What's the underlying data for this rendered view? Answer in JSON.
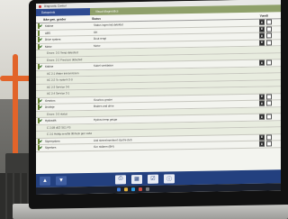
{
  "app": {
    "title": "Diagnostic Control",
    "tabs": [
      {
        "label": "Datapoints",
        "active": true
      },
      {
        "label": "Visual diagnostics",
        "active": false
      }
    ]
  },
  "table": {
    "headers": [
      "Ikke gen. grader",
      "Status",
      "Værdi"
    ],
    "rows": [
      {
        "label": "Kabine",
        "desc": "Status ingen fejl detektet",
        "checked": true,
        "type": "main"
      },
      {
        "label": "ABS",
        "desc": "OK",
        "checked": false,
        "type": "main"
      },
      {
        "label": "Drive system",
        "desc": "Dout rengt",
        "checked": true,
        "type": "main"
      },
      {
        "label": "Motor",
        "desc": "Motor",
        "checked": true,
        "type": "main"
      },
      {
        "label": "Errors: 3-3 Temp detected",
        "desc": "",
        "checked": false,
        "type": "sub"
      },
      {
        "label": "Errors: 2-2 Pressure detected",
        "desc": "",
        "checked": false,
        "type": "sub"
      },
      {
        "label": "Kabine",
        "desc": "Kabel ventilation",
        "checked": true,
        "type": "main"
      },
      {
        "label": "AC 2:1 Water transmission",
        "desc": "",
        "checked": false,
        "type": "sub"
      },
      {
        "label": "AC 2:2 To system 3-0",
        "desc": "",
        "checked": false,
        "type": "sub"
      },
      {
        "label": "AC 2:3 Service 3-0",
        "desc": "",
        "checked": false,
        "type": "sub"
      },
      {
        "label": "AC 2:4 Service 3-1",
        "desc": "",
        "checked": false,
        "type": "sub"
      },
      {
        "label": "Gearbox",
        "desc": "Gearbox grader",
        "checked": true,
        "type": "main"
      },
      {
        "label": "Drivlinje",
        "desc": "Brakes and drive",
        "checked": true,
        "type": "main"
      },
      {
        "label": "Errors: 3-3 status",
        "desc": "",
        "checked": false,
        "type": "sub"
      },
      {
        "label": "Hydraulik",
        "desc": "Hydrau temp gauge",
        "checked": true,
        "type": "main"
      },
      {
        "label": "C 2,5B dE3 SE1 FS",
        "desc": "",
        "checked": false,
        "type": "sub"
      },
      {
        "label": "C 2,5 Hdrlig sensfel tilbhvsk gen valve",
        "desc": "",
        "checked": false,
        "type": "sub"
      },
      {
        "label": "Styresystem",
        "desc": "Anti steerelmenteert stystre (tel)",
        "checked": true,
        "type": "main"
      },
      {
        "label": "Styrelses",
        "desc": "Ger stdlarm (BH)",
        "checked": true,
        "type": "main"
      }
    ]
  },
  "toolbar": {
    "buttons": [
      {
        "name": "up-arrow-icon",
        "glyph": "▲"
      },
      {
        "name": "down-arrow-icon",
        "glyph": "▼"
      },
      {
        "name": "print-icon",
        "glyph": "⎙"
      },
      {
        "name": "grid-icon",
        "glyph": "▦"
      },
      {
        "name": "checkbox-icon",
        "glyph": "☑"
      },
      {
        "name": "info-icon",
        "glyph": "ⓘ"
      }
    ]
  },
  "colors": {
    "tab_active": "#2f4b91",
    "tab_inactive": "#8fa06a",
    "toolbar": "#23407f",
    "checkbox_green": "#6f8a3a"
  }
}
